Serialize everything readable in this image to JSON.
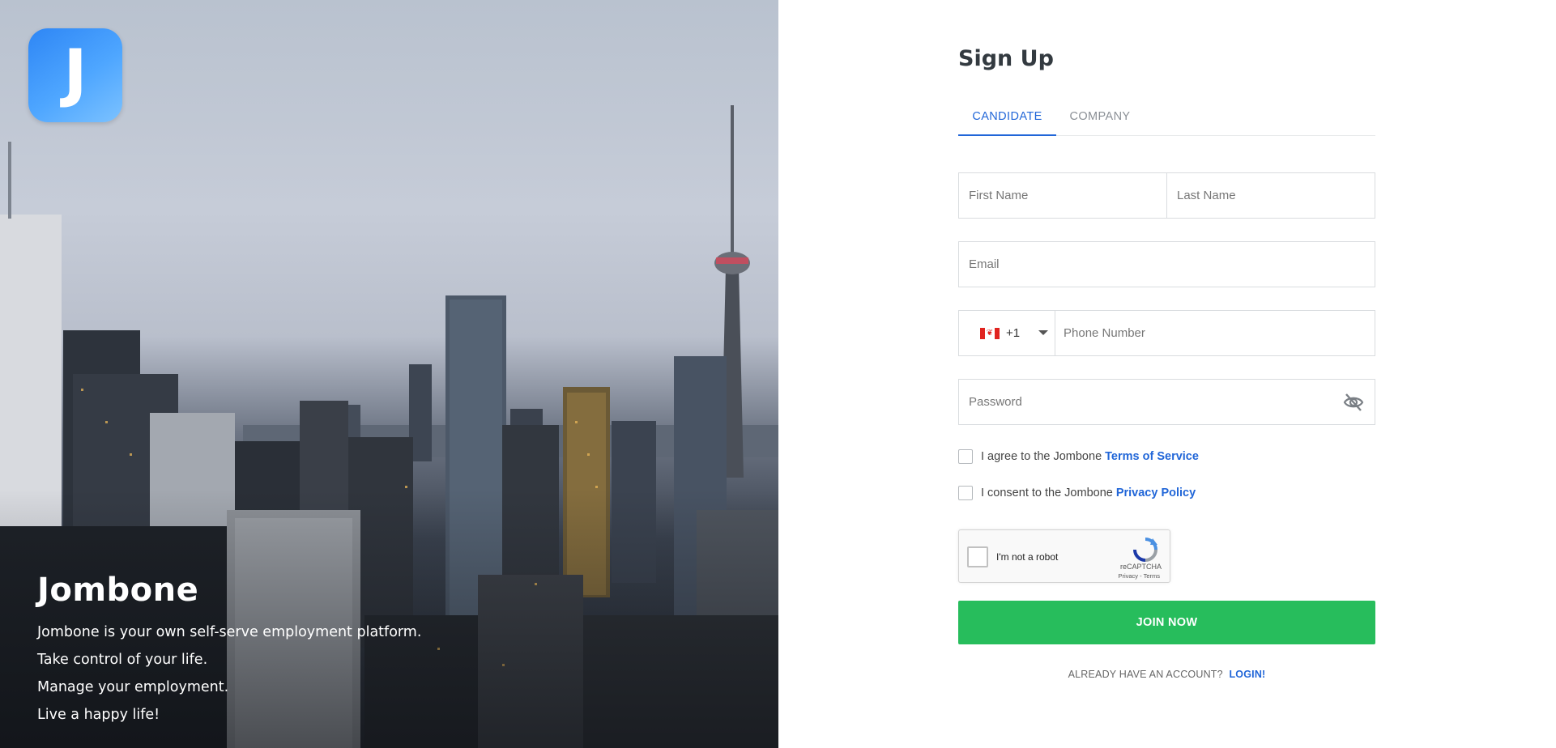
{
  "hero": {
    "logo_letter": "J",
    "brand": "Jombone",
    "lines": [
      "Jombone is your own self-serve employment platform.",
      "Take control of your life.",
      "Manage your employment.",
      "Live a happy life!"
    ]
  },
  "form": {
    "title": "Sign Up",
    "tabs": [
      {
        "label": "CANDIDATE",
        "active": true
      },
      {
        "label": "COMPANY",
        "active": false
      }
    ],
    "first_name_placeholder": "First Name",
    "last_name_placeholder": "Last Name",
    "email_placeholder": "Email",
    "phone": {
      "country_flag": "canada-flag-icon",
      "dial_code": "+1",
      "placeholder": "Phone Number"
    },
    "password_placeholder": "Password",
    "terms": {
      "text": "I agree to the Jombone",
      "link": "Terms of Service"
    },
    "privacy": {
      "text": "I consent to the Jombone",
      "link": "Privacy Policy"
    },
    "captcha": {
      "label": "I'm not a robot",
      "brand": "reCAPTCHA",
      "links": "Privacy - Terms"
    },
    "submit_label": "JOIN NOW",
    "login_prompt": "ALREADY HAVE AN ACCOUNT?",
    "login_link": "LOGIN!"
  },
  "colors": {
    "accent": "#2166d8",
    "submit": "#27bd5c",
    "logo": "#3a93f7"
  }
}
